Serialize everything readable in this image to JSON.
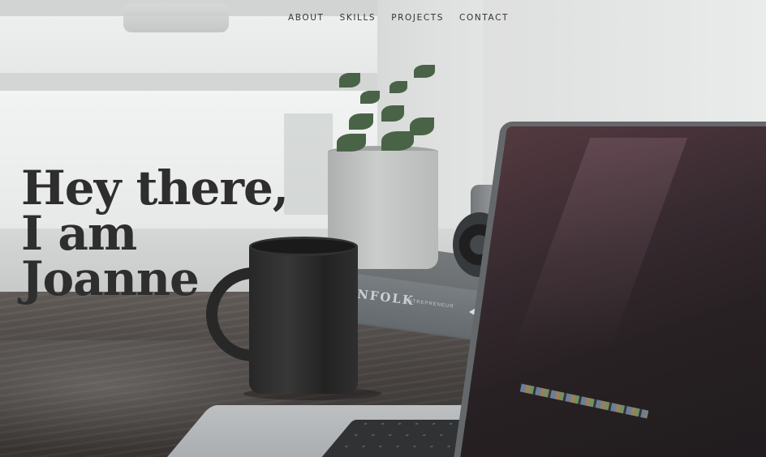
{
  "nav": {
    "items": [
      {
        "label": "ABOUT"
      },
      {
        "label": "SKILLS"
      },
      {
        "label": "PROJECTS"
      },
      {
        "label": "CONTACT"
      }
    ]
  },
  "hero": {
    "headline_lines": [
      "Hey there,",
      "I am",
      "Joanne"
    ],
    "book_title": "NFOLK",
    "book_subtitle": "ENTREPRENEUR"
  },
  "colors": {
    "headline": "#2e2e2e",
    "nav_text": "#333333",
    "wall": "#e3e5e4",
    "table": "#3f3a37"
  }
}
